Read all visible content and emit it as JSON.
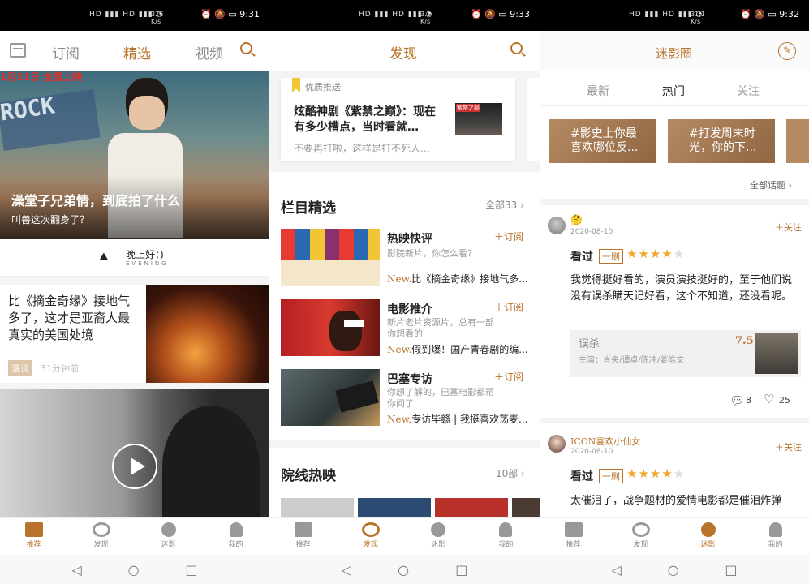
{
  "status": [
    {
      "net": "326 K/s",
      "time": "9:31"
    },
    {
      "net": "3.1 K/s",
      "time": "9:33"
    },
    {
      "net": "31.1 K/s",
      "time": "9:32"
    }
  ],
  "bottom_nav": [
    {
      "label": "推荐"
    },
    {
      "label": "发现"
    },
    {
      "label": "迷影"
    },
    {
      "label": "我的"
    }
  ],
  "p1": {
    "tabs": [
      "订阅",
      "精选",
      "视频"
    ],
    "hero": {
      "poster_text": "1月11日 全国上映",
      "title": "澡堂子兄弟情，到底拍了什么",
      "subtitle": "叫兽这次翻身了？"
    },
    "greeting": {
      "main": "晚上好：)",
      "sub": "EVENING"
    },
    "article": {
      "title": "比《摘金奇缘》接地气多了，这才是亚裔人最真实的美国处境",
      "tag": "漫谈",
      "time": "31分钟前"
    }
  },
  "p2": {
    "title": "发现",
    "featured": {
      "tag": "优质推送",
      "title": "炫酷神剧《紫禁之巅》：现在有多少槽点，当时看就…",
      "desc": "不要再打啦，这样是打不死人…",
      "thumb_text": "紫禁之巅"
    },
    "section": {
      "title": "栏目精选",
      "more": "全部33"
    },
    "columns": [
      {
        "title": "热映快评",
        "subscribe": "＋订阅",
        "desc": "影院新片，你怎么看？",
        "new_label": "New.",
        "new_text": "比《摘金奇缘》接地气多..."
      },
      {
        "title": "电影推介",
        "subscribe": "＋订阅",
        "desc": "新片老片资源片，总有一部你想看的",
        "new_label": "New.",
        "new_text": "假到爆！国产青春剧的编..."
      },
      {
        "title": "巴塞专访",
        "subscribe": "＋订阅",
        "desc": "你想了解的，巴塞电影都帮你问了",
        "new_label": "New.",
        "new_text": "专访毕赣 | 我挺喜欢荡麦..."
      }
    ],
    "section2": {
      "title": "院线热映",
      "more": "10部"
    }
  },
  "p3": {
    "title": "迷影圈",
    "tabs": [
      "最新",
      "热门",
      "关注"
    ],
    "topics": [
      "#影史上你最喜欢哪位反...",
      "#打发周末时光，你的下..."
    ],
    "all_topics": "全部话题",
    "posts": [
      {
        "user": "",
        "date": "2020-08-10",
        "follow": "＋关注",
        "seen": "看过",
        "count": "一刷",
        "stars": 4,
        "text": "我觉得挺好看的，演员演技挺好的，至于他们说没有误杀瞒天记好看，这个不知道，还没看呢。",
        "movie": {
          "name": "误杀",
          "score": "7.5",
          "cast": "主演：肖央/谭卓/陈冲/姜皓文"
        },
        "comments": "8",
        "likes": "25"
      },
      {
        "user": "ICON喜欢小仙女",
        "date": "2020-08-10",
        "follow": "＋关注",
        "seen": "看过",
        "count": "一刷",
        "stars": 4,
        "text": "太催泪了，战争题材的爱情电影都是催泪炸弹"
      }
    ]
  },
  "colors": {
    "accent": "#b8742c",
    "badge": "#dec6ab"
  }
}
